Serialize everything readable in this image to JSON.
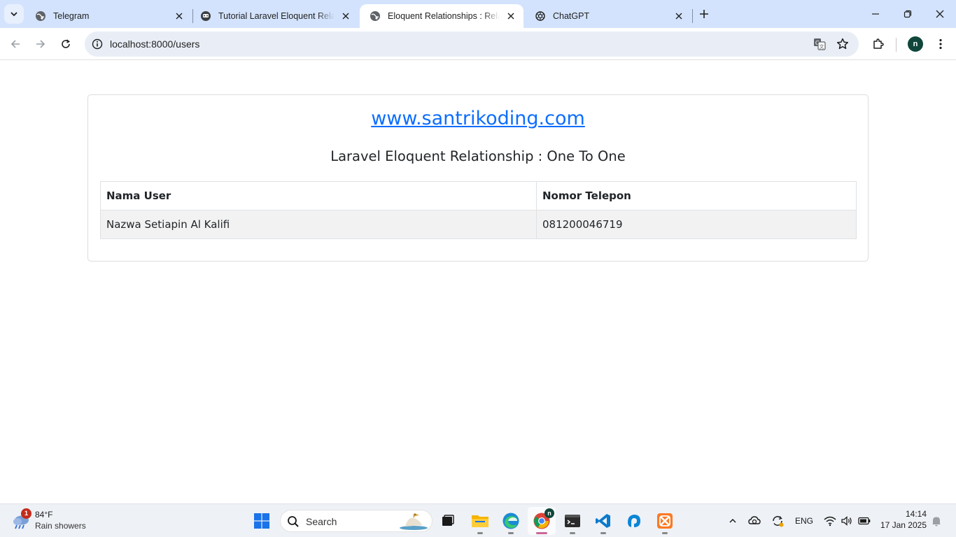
{
  "browser": {
    "tabs": [
      {
        "title": "Telegram",
        "active": false
      },
      {
        "title": "Tutorial Laravel Eloquent Relatio",
        "active": false
      },
      {
        "title": "Eloquent Relationships : Relasi O",
        "active": true
      },
      {
        "title": "ChatGPT",
        "active": false
      }
    ],
    "url": "localhost:8000/users",
    "profile_initial": "n"
  },
  "page": {
    "site_link": "www.santrikoding.com",
    "heading": "Laravel Eloquent Relationship : One To One",
    "table": {
      "headers": [
        "Nama User",
        "Nomor Telepon"
      ],
      "rows": [
        [
          "Nazwa Setiapin Al Kalifi",
          "081200046719"
        ]
      ]
    }
  },
  "taskbar": {
    "weather": {
      "temp": "84°F",
      "condition": "Rain showers",
      "badge": "1"
    },
    "search_placeholder": "Search",
    "apps": [
      "start-icon",
      "file-explorer-icon",
      "edge-icon",
      "chrome-icon",
      "terminal-icon",
      "vscode-icon",
      "app-blue-icon",
      "xampp-icon"
    ],
    "chrome_badge": "n",
    "language": "ENG",
    "time": "14:14",
    "date": "17 Jan 2025"
  },
  "colors": {
    "tabstrip": "#d3e3fd",
    "link": "#0d6efd",
    "row_stripe": "#f2f2f2"
  }
}
